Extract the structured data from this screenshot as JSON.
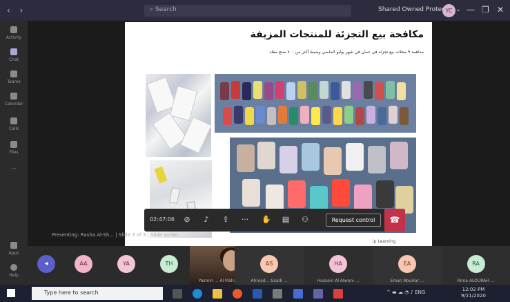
{
  "titlebar": {
    "search_placeholder": "Search",
    "org_name": "Shared Owned Protect... ⌄",
    "user_initials": "YC",
    "minimize": "—",
    "maximize": "❐",
    "close": "✕"
  },
  "rail": [
    {
      "label": "Activity",
      "icon": "bell-icon"
    },
    {
      "label": "Chat",
      "icon": "chat-icon"
    },
    {
      "label": "Teams",
      "icon": "teams-icon"
    },
    {
      "label": "Calendar",
      "icon": "calendar-icon"
    },
    {
      "label": "Calls",
      "icon": "phone-icon"
    },
    {
      "label": "Files",
      "icon": "file-icon"
    },
    {
      "label": "···",
      "icon": "more-icon"
    },
    {
      "label": "Apps",
      "icon": "apps-icon"
    },
    {
      "label": "Help",
      "icon": "help-icon"
    }
  ],
  "slide": {
    "title": "مكافحة بيع التجزئة للمنتجات المزيفة",
    "subtitle": "مداهمة ٩ محلات بيع تجزئة في عمان في شهر يوليو الماضي وضبط أكثر من ٧٠٠ منتج مقلد",
    "footer": "ip Learning"
  },
  "controls": {
    "timer": "02:47:06",
    "request_control_label": "Request control"
  },
  "presenter_label": "Presenting: Rasha Al-Sh... | Slide 3 of 3 | Slide sorter",
  "gallery": [
    {
      "initials": "AA",
      "color": "#f0b6c8",
      "text_color": "#6a2541"
    },
    {
      "initials": "YA",
      "color": "#f3c6d4",
      "text_color": "#6a2541"
    },
    {
      "initials": "TH",
      "color": "#c8ebd3",
      "text_color": "#1e5e35"
    },
    {
      "initials": "AS",
      "color": "#f6c7b1",
      "text_color": "#7a3213",
      "name": "Ahmad ...Saadi ..."
    },
    {
      "initials": "HA",
      "color": "#f2c3d6",
      "text_color": "#6a2541",
      "name": "Hussein Al Alwani ..."
    },
    {
      "initials": "EA",
      "color": "#f6c7b1",
      "text_color": "#7a3213",
      "name": "Eman AbuHar ..."
    },
    {
      "initials": "RA",
      "color": "#c8ebd3",
      "text_color": "#1e5e35",
      "name": "Rima ALOURAH ..."
    }
  ],
  "video_name": "Yasmin ... Al Maharmeh",
  "taskbar": {
    "search_placeholder": "Type here to search",
    "tray_lang": "ENG",
    "time": "12:02 PM",
    "date": "9/21/2020"
  }
}
